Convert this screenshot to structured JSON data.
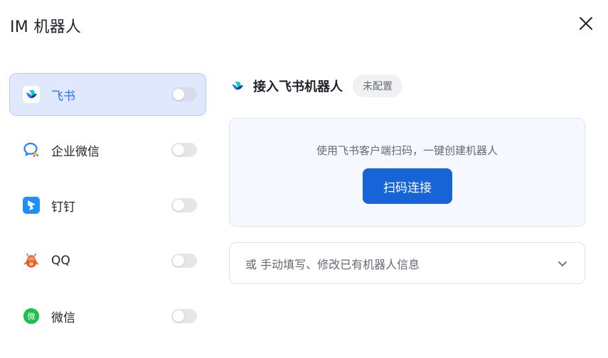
{
  "dialog": {
    "title": "IM 机器人"
  },
  "sidebar": {
    "items": [
      {
        "label": "飞书",
        "icon": "feishu-icon",
        "active": true,
        "enabled": false
      },
      {
        "label": "企业微信",
        "icon": "wecom-icon",
        "active": false,
        "enabled": false
      },
      {
        "label": "钉钉",
        "icon": "dingtalk-icon",
        "active": false,
        "enabled": false
      },
      {
        "label": "QQ",
        "icon": "qq-icon",
        "active": false,
        "enabled": false
      },
      {
        "label": "微信",
        "icon": "wechat-icon",
        "active": false,
        "enabled": false
      }
    ]
  },
  "main": {
    "header_title": "接入飞书机器人",
    "status_badge": "未配置",
    "qr": {
      "description": "使用飞书客户端扫码，一键创建机器人",
      "button_label": "扫码连接"
    },
    "manual": {
      "label": "或 手动填写、修改已有机器人信息"
    }
  },
  "colors": {
    "accent": "#3370ff",
    "primary_button": "#1664d8",
    "active_bg": "#dfe8fd"
  }
}
